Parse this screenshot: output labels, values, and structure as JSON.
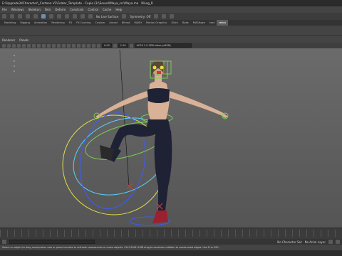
{
  "titlebar": {
    "title": "E:\\Upgrade3dCharacter\\_Cartoon V3\\Folder_Template - Copie (3)\\Sound\\Maya_src\\Maya.ma",
    "selection": "IKLeg_R"
  },
  "menubar": {
    "items": [
      "File",
      "Windows",
      "Skeleton",
      "Skin",
      "Deform",
      "Constrain",
      "Control",
      "Cache",
      "Help"
    ]
  },
  "statusline": {
    "live_surface": "No Live Surface",
    "symmetry": "Symmetry: Off"
  },
  "shelf_tabs": {
    "items": [
      "Modeling",
      "Rigging",
      "Animation",
      "Rendering",
      "FX",
      "FX Caching",
      "Custom",
      "Arnold",
      "Bifrost",
      "MASH",
      "Motion Graphics",
      "XGen",
      "Bake",
      "MASHgen",
      "test",
      "zebra"
    ],
    "active_index": 15
  },
  "panel_menu": {
    "items": [
      "Renderer",
      "Panels"
    ]
  },
  "panel_toolbar": {
    "field_value": "0.00",
    "field_value2": "1.00",
    "color_space": "ACES 1.0 SDR-video (sRGB)"
  },
  "range_bar": {
    "character_set": "No Character Set",
    "anim_layer": "No Anim Layer"
  },
  "help_line": {
    "text": "Select an object to drag manipulator axis or plane handles to activate components or move objects. Ctrl+Shift+LMB drag to constrain rotation to constrained edges. Use D or INS..."
  },
  "colors": {
    "viewport_bg": "#5f5f5f",
    "outfit": "#1f2135",
    "skin": "#d8b197",
    "control_green": "#7ccc4e",
    "control_yellow": "#e2e04a",
    "control_cyan": "#5ad2ff",
    "control_blue": "#3c5cff",
    "pole_red": "#e0332d"
  }
}
